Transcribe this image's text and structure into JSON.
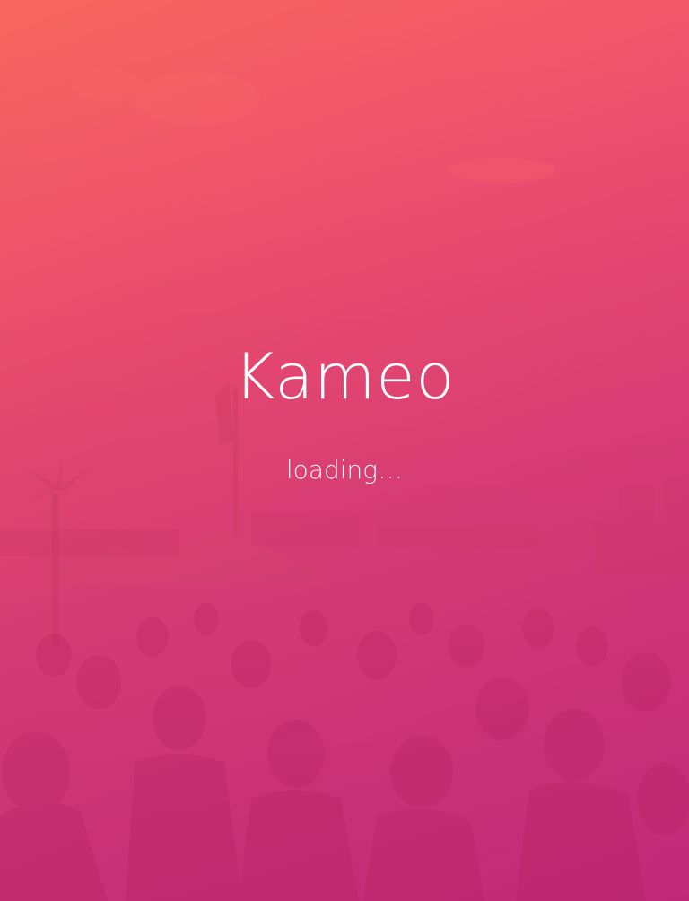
{
  "app": {
    "title": "Kameo",
    "status": "loading…"
  },
  "colors": {
    "gradient_top_left": "#f76361",
    "gradient_mid": "#e5446f",
    "gradient_bottom_right": "#c92a7c",
    "text": "#ffffff"
  },
  "background": {
    "icon": "crowd-photo"
  }
}
